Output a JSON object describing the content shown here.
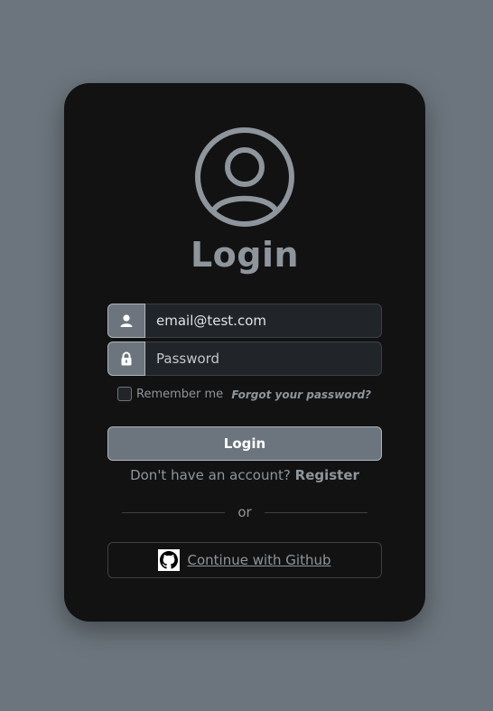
{
  "login": {
    "title": "Login",
    "email": {
      "value": "email@test.com",
      "placeholder": "email@test.com"
    },
    "password": {
      "value": "",
      "placeholder": "Password"
    },
    "remember_label": "Remember me",
    "forgot_label": "Forgot your password?",
    "submit_label": "Login",
    "no_account_text": "Don't have an account?",
    "register_label": "Register",
    "divider_text": "or",
    "github_label": "Continue with Github"
  },
  "icons": {
    "avatar": "user-circle-icon",
    "email": "user-icon",
    "password": "lock-icon",
    "github": "github-icon"
  },
  "colors": {
    "page_background": "#6c757d",
    "card_background": "#121212",
    "muted_text": "#8e959c",
    "button_background": "#6c757d"
  }
}
